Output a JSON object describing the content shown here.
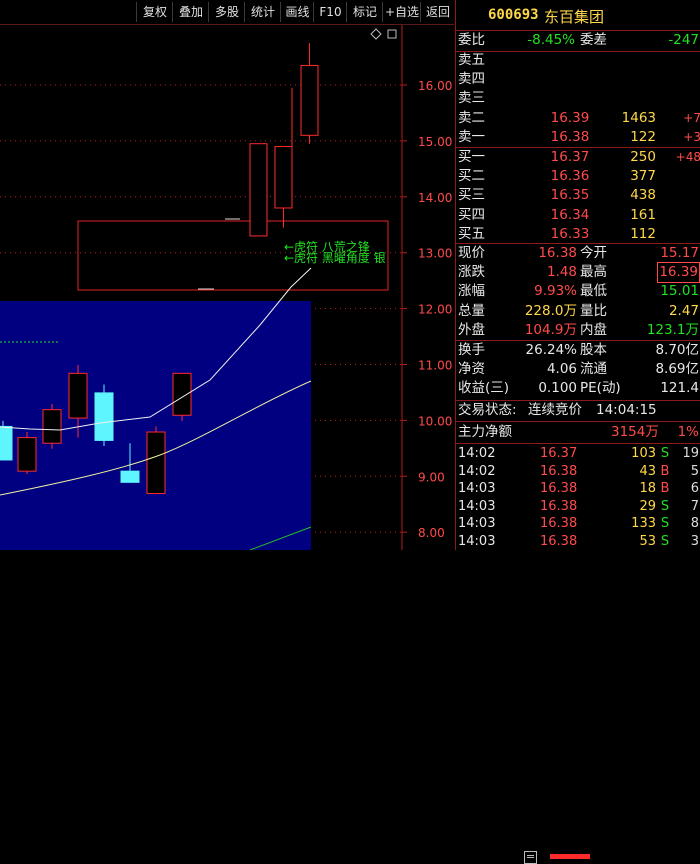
{
  "toolbar": {
    "buttons": [
      "复权",
      "叠加",
      "多股",
      "统计",
      "画线",
      "F10",
      "标记",
      "+自选",
      "返回"
    ]
  },
  "chart": {
    "y_ticks": [
      "16.00",
      "15.00",
      "14.00",
      "13.00",
      "12.00",
      "11.00",
      "10.00",
      "9.00",
      "8.00"
    ],
    "annotation_line1": "←虎符 八荒之锋",
    "annotation_line2": "←虎符 黑曜角度 银",
    "diamond_icon": "diamond-icon",
    "small_box_icon": "box-icon",
    "colors": {
      "up": "#ff2b2b",
      "down_fill": "#5ff5ff",
      "overlay_bg": "#000080",
      "axis_text": "#ff4b4b"
    }
  },
  "chart_data": {
    "type": "candlestick",
    "main_candles": [
      {
        "open": 13.3,
        "high": 14.95,
        "low": 13.6,
        "close": 14.95
      },
      {
        "open": 13.8,
        "high": 14.9,
        "low": 13.45,
        "close": 14.9
      },
      {
        "open": 14.0,
        "high": 15.95,
        "low": 13.5,
        "close": 14.0
      },
      {
        "open": 15.1,
        "high": 16.75,
        "low": 14.95,
        "close": 16.35
      }
    ],
    "inset_candles": [
      {
        "open": 10.35,
        "high": 10.45,
        "low": 9.75,
        "close": 9.75,
        "dir": "down"
      },
      {
        "open": 9.55,
        "high": 10.25,
        "low": 9.5,
        "close": 10.15,
        "dir": "up"
      },
      {
        "open": 10.05,
        "high": 10.75,
        "low": 9.95,
        "close": 10.65,
        "dir": "up"
      },
      {
        "open": 10.5,
        "high": 11.45,
        "low": 10.15,
        "close": 11.3,
        "dir": "up"
      },
      {
        "open": 10.95,
        "high": 11.1,
        "low": 10.0,
        "close": 10.1,
        "dir": "down"
      },
      {
        "open": 9.55,
        "high": 10.05,
        "low": 9.35,
        "close": 9.35,
        "dir": "down"
      },
      {
        "open": 9.15,
        "high": 10.35,
        "low": 9.15,
        "close": 10.25,
        "dir": "up"
      },
      {
        "open": 10.55,
        "high": 11.3,
        "low": 10.45,
        "close": 11.3,
        "dir": "up"
      }
    ]
  },
  "panel": {
    "code": "600693",
    "name": "东百集团",
    "weibi_label": "委比",
    "weibi_value": "-8.45%",
    "weicha_label": "委差",
    "weicha_value": "-247",
    "sells": [
      {
        "label": "卖五",
        "price": "",
        "vol": "",
        "chg": ""
      },
      {
        "label": "卖四",
        "price": "",
        "vol": "",
        "chg": ""
      },
      {
        "label": "卖三",
        "price": "",
        "vol": "",
        "chg": ""
      },
      {
        "label": "卖二",
        "price": "16.39",
        "vol": "1463",
        "chg": "+7"
      },
      {
        "label": "卖一",
        "price": "16.38",
        "vol": "122",
        "chg": "+3"
      }
    ],
    "buys": [
      {
        "label": "买一",
        "price": "16.37",
        "vol": "250",
        "chg": "+48"
      },
      {
        "label": "买二",
        "price": "16.36",
        "vol": "377",
        "chg": ""
      },
      {
        "label": "买三",
        "price": "16.35",
        "vol": "438",
        "chg": ""
      },
      {
        "label": "买四",
        "price": "16.34",
        "vol": "161",
        "chg": ""
      },
      {
        "label": "买五",
        "price": "16.33",
        "vol": "112",
        "chg": ""
      }
    ],
    "stats": [
      {
        "l": "现价",
        "v1": "16.38",
        "l2": "今开",
        "v2": "15.17"
      },
      {
        "l": "涨跌",
        "v1": "1.48",
        "l2": "最高",
        "v2": "16.39"
      },
      {
        "l": "涨幅",
        "v1": "9.93%",
        "l2": "最低",
        "v2": "15.01"
      },
      {
        "l": "总量",
        "v1": "228.0万",
        "l2": "量比",
        "v2": "2.47"
      },
      {
        "l": "外盘",
        "v1": "104.9万",
        "l2": "内盘",
        "v2": "123.1万"
      }
    ],
    "stats2": [
      {
        "l": "换手",
        "v1": "26.24%",
        "l2": "股本",
        "v2": "8.70亿"
      },
      {
        "l": "净资",
        "v1": "4.06",
        "l2": "流通",
        "v2": "8.69亿"
      },
      {
        "l": "收益(三)",
        "v1": "0.100",
        "l2": "PE(动)",
        "v2": "121.4"
      }
    ],
    "trade_status_label": "交易状态:",
    "trade_status": "连续竞价",
    "trade_time": "14:04:15",
    "main_net_label": "主力净额",
    "main_net_value": "3154万",
    "main_net_pct": "1%",
    "ticks": [
      {
        "t": "14:02",
        "p": "16.37",
        "q": "103",
        "d": "S",
        "n": "19"
      },
      {
        "t": "14:02",
        "p": "16.38",
        "q": "43",
        "d": "B",
        "n": "5"
      },
      {
        "t": "14:03",
        "p": "16.38",
        "q": "18",
        "d": "B",
        "n": "6"
      },
      {
        "t": "14:03",
        "p": "16.38",
        "q": "29",
        "d": "S",
        "n": "7"
      },
      {
        "t": "14:03",
        "p": "16.38",
        "q": "133",
        "d": "S",
        "n": "8"
      },
      {
        "t": "14:03",
        "p": "16.38",
        "q": "53",
        "d": "S",
        "n": "3"
      }
    ]
  }
}
